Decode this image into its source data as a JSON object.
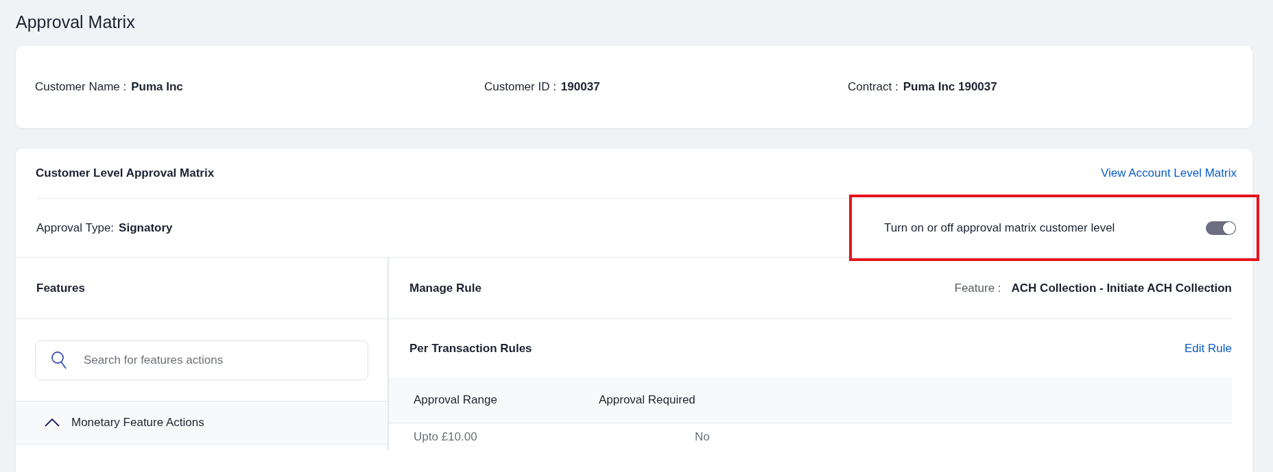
{
  "page_title": "Approval Matrix",
  "customer_info": [
    {
      "label": "Customer Name :",
      "value": "Puma Inc"
    },
    {
      "label": "Customer ID :",
      "value": "190037"
    },
    {
      "label": "Contract :",
      "value": "Puma Inc 190037"
    }
  ],
  "matrix": {
    "title": "Customer Level Approval Matrix",
    "link": "View Account Level Matrix",
    "approval_type": {
      "label": "Approval Type:",
      "value": "Signatory"
    },
    "toggle": {
      "label": "Turn on or off approval matrix customer level",
      "on": true,
      "highlighted": true
    }
  },
  "features": {
    "title": "Features",
    "search": {
      "placeholder": "Search for features actions"
    },
    "groups": [
      {
        "label": "Monetary Feature Actions",
        "expanded": true
      }
    ]
  },
  "manage_rule": {
    "title": "Manage Rule",
    "feature_label": "Feature :",
    "feature_value": "ACH Collection - Initiate ACH Collection",
    "section_title": "Per Transaction Rules",
    "edit_link": "Edit Rule",
    "columns": [
      "Approval Range",
      "Approval Required"
    ],
    "rows": [
      [
        "Upto £10.00",
        "No"
      ]
    ]
  }
}
